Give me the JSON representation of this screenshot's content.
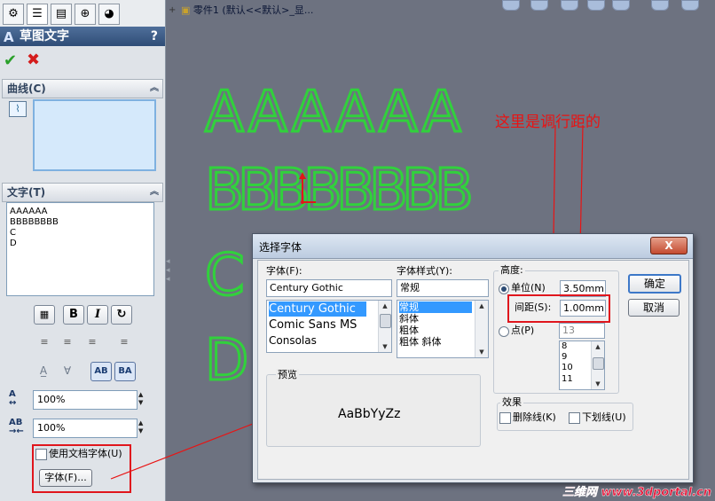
{
  "property_manager": {
    "title": "草图文字",
    "help": "?",
    "groups": {
      "curve": {
        "label": "曲线(C)"
      },
      "text": {
        "label": "文字(T)"
      }
    },
    "text_lines": [
      "AAAAAA",
      "BBBBBBBB",
      "C",
      "D"
    ],
    "width_factor": "100%",
    "spacing_factor": "100%",
    "use_doc_font_label": "使用文档字体(U)",
    "font_button_label": "字体(F)..."
  },
  "canvas": {
    "tree_item": "零件1  (默认<<默认>_显...",
    "sketch_glyphs": {
      "row_a": [
        "A",
        "A",
        "A",
        "A",
        "A",
        "A"
      ],
      "row_b": [
        "B",
        "B",
        "B",
        "B",
        "B",
        "B",
        "B",
        "B"
      ],
      "row_c": "C",
      "row_d": "D"
    },
    "annotation": "这里是调行距的"
  },
  "font_dialog": {
    "title": "选择字体",
    "close_label": "X",
    "font_label": "字体(F):",
    "font_value": "Century Gothic",
    "font_list": [
      "Century Gothic",
      "Comic Sans MS",
      "Consolas"
    ],
    "style_label": "字体样式(Y):",
    "style_value": "常规",
    "style_list": [
      "常规",
      "斜体",
      "粗体",
      "粗体 斜体"
    ],
    "height_label": "高度:",
    "unit_label": "单位(N)",
    "unit_value": "3.50mm",
    "spacing_label": "间距(S):",
    "spacing_value": "1.00mm",
    "points_label": "点(P)",
    "points_value": "13",
    "points_list": [
      "8",
      "9",
      "10",
      "11"
    ],
    "preview_label": "预览",
    "preview_text": "AaBbYyZz",
    "effects_label": "效果",
    "strikeout_label": "删除线(K)",
    "underline_label": "下划线(U)",
    "ok_label": "确定",
    "cancel_label": "取消"
  },
  "watermark": "三维网 www.3dportal.cn",
  "colors": {
    "sketch_green": "#31d13c",
    "annotation_red": "#e81414",
    "canvas_bg": "#6d7280",
    "selection_blue": "#3399ff"
  }
}
